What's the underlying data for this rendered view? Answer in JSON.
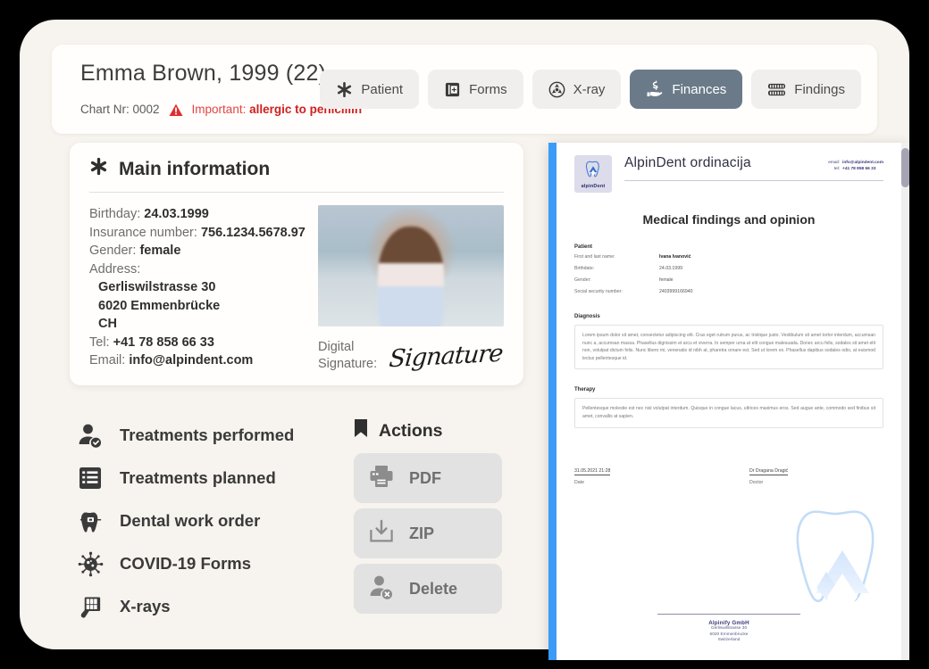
{
  "header": {
    "patient_title": "Emma Brown, 1999 (22)",
    "chart_label": "Chart Nr: 0002",
    "important_prefix": "Important:",
    "important_value": "allergic to penicillin",
    "warning_icon": "warning-triangle-icon"
  },
  "tabs": [
    {
      "label": "Patient",
      "icon": "asterisk-icon",
      "active": false
    },
    {
      "label": "Forms",
      "icon": "form-book-icon",
      "active": false
    },
    {
      "label": "X-ray",
      "icon": "radiation-icon",
      "active": false
    },
    {
      "label": "Finances",
      "icon": "hand-money-icon",
      "active": true
    },
    {
      "label": "Findings",
      "icon": "teeth-icon",
      "active": false
    }
  ],
  "main_info": {
    "heading": "Main information",
    "heading_icon": "asterisk-icon",
    "birthday_label": "Birthday:",
    "birthday_value": "24.03.1999",
    "insurance_label": "Insurance number:",
    "insurance_value": "756.1234.5678.97",
    "gender_label": "Gender:",
    "gender_value": "female",
    "address_label": "Address:",
    "address_street": "Gerliswilstrasse 30",
    "address_city": "6020 Emmenbrücke",
    "address_country": "CH",
    "tel_label": "Tel:",
    "tel_value": "+41 78 858 66 33",
    "email_label": "Email:",
    "email_value": "info@alpindent.com",
    "signature_label_line1": "Digital",
    "signature_label_line2": "Signature:",
    "signature_text": "Signature"
  },
  "menu": [
    {
      "label": "Treatments performed",
      "icon": "person-check-icon"
    },
    {
      "label": "Treatments planned",
      "icon": "list-icon"
    },
    {
      "label": "Dental work order",
      "icon": "tooth-braces-icon"
    },
    {
      "label": "COVID-19 Forms",
      "icon": "virus-icon"
    },
    {
      "label": "X-rays",
      "icon": "xray-film-icon"
    }
  ],
  "actions": {
    "heading": "Actions",
    "heading_icon": "bookmark-icon",
    "buttons": [
      {
        "label": "PDF",
        "icon": "printer-icon"
      },
      {
        "label": "ZIP",
        "icon": "download-icon"
      },
      {
        "label": "Delete",
        "icon": "person-delete-icon"
      }
    ]
  },
  "document": {
    "logo_text": "alpinDent",
    "logo_icon": "tooth-mountain-icon",
    "brand": "AlpinDent ordinacija",
    "email_label": "email:",
    "email_value": "info@alpindent.com",
    "tel_label": "tel:",
    "tel_value": "+41 78 858 66 33",
    "title": "Medical findings and opinion",
    "patient_section": {
      "heading": "Patient",
      "rows": [
        {
          "key": "First and last name:",
          "value": "Ivana Ivanović",
          "bold": true
        },
        {
          "key": "Birthdate:",
          "value": "24.03.1999",
          "bold": false
        },
        {
          "key": "Gender:",
          "value": "female",
          "bold": false
        },
        {
          "key": "Social security number:",
          "value": "2403999166940",
          "bold": false
        }
      ]
    },
    "diagnosis": {
      "heading": "Diagnosis",
      "text": "Lorem ipsum dolor sit amet, consectetur adipiscing elit. Cras eget rutrum purus, ac tristique justo. Vestibulum sit amet tortor interdum, accumsan nunc a, accumsan massa. Phasellus dignissim et arcu et viverra. In semper urna at elit congue malesuada. Donec arcu felis, sodales sit amet elit non, volutpat dictum felis. Nunc libero mi, venenatis id nibh at, pharetra ornare est. Sed ut lorem ex. Phasellus dapibus sodales odio, at euismod lectus pellentesque id."
    },
    "therapy": {
      "heading": "Therapy",
      "text": "Pellentesque molestie est nec nisl volutpat interdum. Quisque in congue lacus, ultrices maximus eros. Sed augue ante, commodo sed finibus sit amet, convallis at sapien."
    },
    "signatures": {
      "date_value": "31.05.2021 21:28",
      "date_caption": "Date",
      "doctor_value": "Dr Dragana Dragić",
      "doctor_caption": "Doctor"
    },
    "footer": {
      "company": "Alpinify GmbH",
      "street": "Gerliswilstrasse 30",
      "city": "6020 Emmenbrucke",
      "country": "Switzerland"
    },
    "watermark_icon": "tooth-mountain-watermark"
  },
  "colors": {
    "app_bg": "#f7f3ee",
    "accent_active_tab": "#6b7a89",
    "doc_accent_bar": "#3c9bf7",
    "warning_red": "#cf2020"
  }
}
